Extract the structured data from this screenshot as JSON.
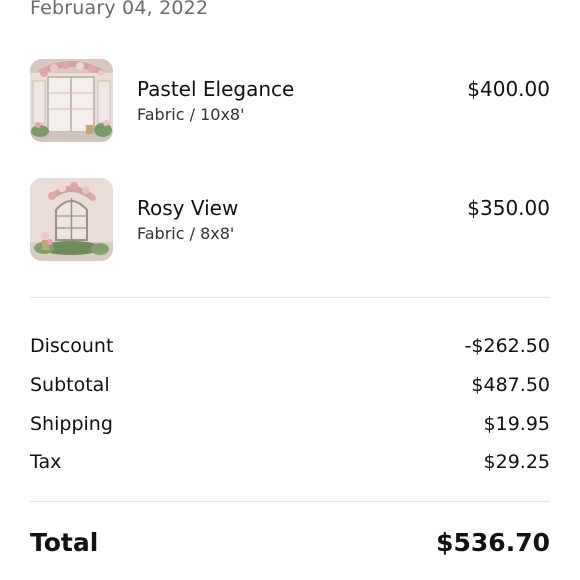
{
  "order": {
    "date": "February 04, 2022"
  },
  "items": [
    {
      "name": "Pastel Elegance",
      "variant": "Fabric / 10x8'",
      "price": "$400.00",
      "image": "pastel-elegance-backdrop-thumbnail"
    },
    {
      "name": "Rosy View",
      "variant": "Fabric / 8x8'",
      "price": "$350.00",
      "image": "rosy-view-backdrop-thumbnail"
    }
  ],
  "summary": {
    "discount_label": "Discount",
    "discount_value": "-$262.50",
    "subtotal_label": "Subtotal",
    "subtotal_value": "$487.50",
    "shipping_label": "Shipping",
    "shipping_value": "$19.95",
    "tax_label": "Tax",
    "tax_value": "$29.25",
    "total_label": "Total",
    "total_value": "$536.70"
  },
  "colors": {
    "text": "#111111",
    "muted": "#6b6b6b",
    "divider": "#e4e4e4"
  }
}
